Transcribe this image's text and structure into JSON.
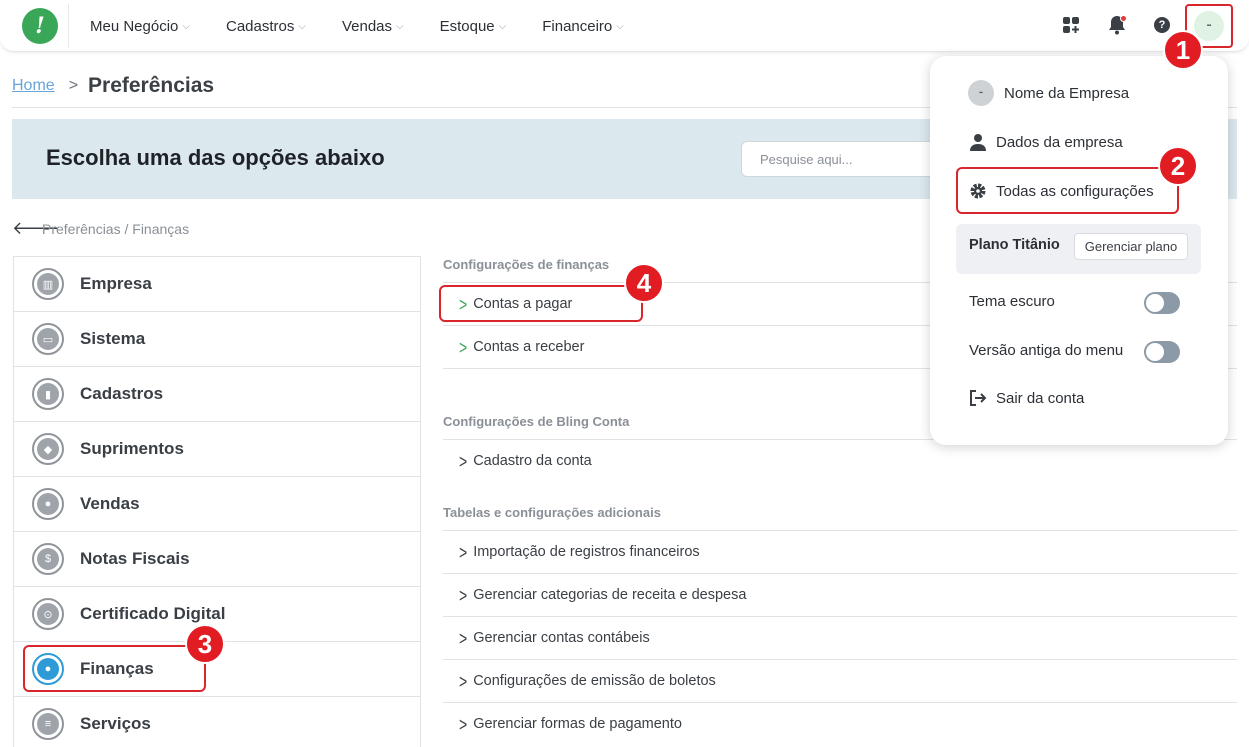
{
  "nav": {
    "logo_glyph": "!",
    "menu": [
      {
        "label": "Meu Negócio"
      },
      {
        "label": "Cadastros"
      },
      {
        "label": "Vendas"
      },
      {
        "label": "Estoque"
      },
      {
        "label": "Financeiro"
      }
    ],
    "icons": [
      "apps-icon",
      "bell-icon",
      "help-icon"
    ],
    "help_glyph": "?"
  },
  "breadcrumb": {
    "home": "Home",
    "separator": ">",
    "title": "Preferências"
  },
  "banner": {
    "title": "Escolha uma das opções abaixo",
    "search_placeholder": "Pesquise aqui..."
  },
  "sub_breadcrumb": "Preferências / Finanças",
  "sidebar": {
    "items": [
      {
        "label": "Empresa",
        "icon": "building-icon",
        "glyph": "▥"
      },
      {
        "label": "Sistema",
        "icon": "monitor-icon",
        "glyph": "▭"
      },
      {
        "label": "Cadastros",
        "icon": "book-icon",
        "glyph": "▮"
      },
      {
        "label": "Suprimentos",
        "icon": "box-icon",
        "glyph": "◆"
      },
      {
        "label": "Vendas",
        "icon": "people-icon",
        "glyph": "●"
      },
      {
        "label": "Notas Fiscais",
        "icon": "invoice-icon",
        "glyph": "$"
      },
      {
        "label": "Certificado Digital",
        "icon": "certificate-icon",
        "glyph": "⊙"
      },
      {
        "label": "Finanças",
        "icon": "piggy-bank-icon",
        "glyph": "●",
        "active": true
      },
      {
        "label": "Serviços",
        "icon": "document-icon",
        "glyph": "≡"
      }
    ]
  },
  "content": {
    "sections": [
      {
        "title": "Configurações de finanças",
        "rows": [
          "Contas a pagar",
          "Contas a receber"
        ]
      },
      {
        "title": "Configurações de Bling Conta",
        "rows": [
          "Cadastro da conta"
        ]
      },
      {
        "title": "Tabelas e configurações adicionais",
        "rows": [
          "Importação de registros financeiros",
          "Gerenciar categorias de receita e despesa",
          "Gerenciar contas contábeis",
          "Configurações de emissão de boletos",
          "Gerenciar formas de pagamento"
        ]
      }
    ]
  },
  "dropdown": {
    "company_name": "Nome da Empresa",
    "company_data": "Dados da empresa",
    "all_settings": "Todas as configurações",
    "plan_label": "Plano Titânio",
    "plan_button": "Gerenciar plano",
    "dark_theme": "Tema escuro",
    "old_menu": "Versão antiga do menu",
    "logout": "Sair da conta"
  },
  "annotations": {
    "badge_1": "1",
    "badge_2": "2",
    "badge_3": "3",
    "badge_4": "4",
    "highlight_color": "#d9262c",
    "badge_color": "#e11d23"
  },
  "colors": {
    "brand_green": "#3aa657",
    "banner_bg": "#dbe8ee",
    "active_blue": "#2e9ad6",
    "link_blue": "#6aa4d8"
  }
}
